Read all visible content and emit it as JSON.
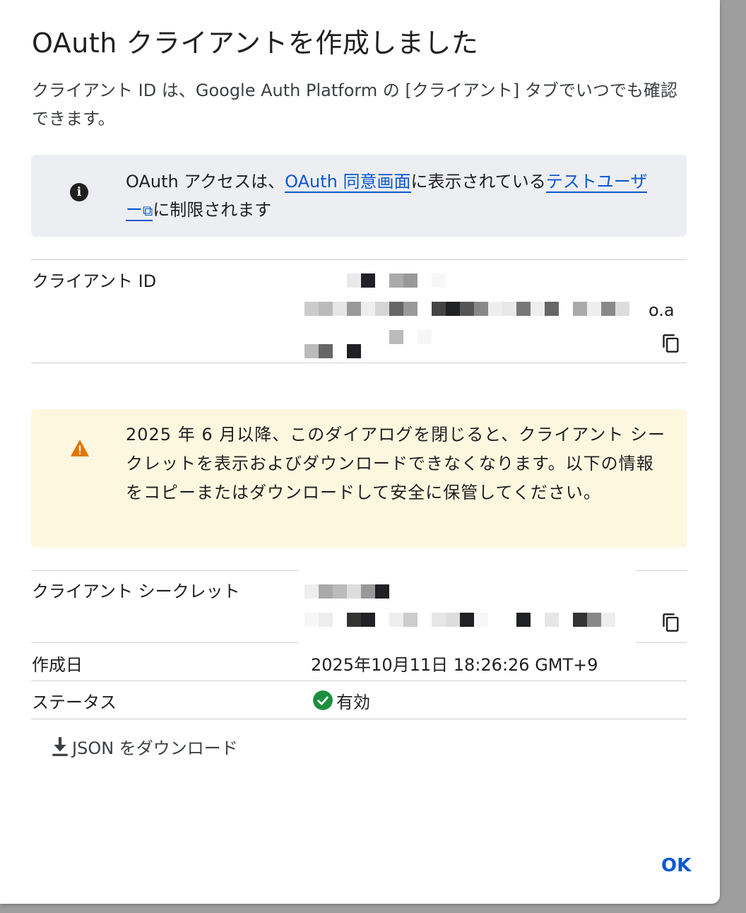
{
  "dialog": {
    "title": "OAuth クライアントを作成しました",
    "description": "クライアント ID は、Google Auth Platform の [クライアント] タブでいつでも確認できます。"
  },
  "info": {
    "icon": "info-icon",
    "text_before": "OAuth アクセスは、",
    "consent_link": "OAuth 同意画面",
    "text_middle": "に表示されている",
    "test_users_link": "テストユーザー",
    "text_after": "に制限されます"
  },
  "client_id": {
    "label": "クライアント ID",
    "visible_suffix": "o.a",
    "copy_icon": "copy-icon"
  },
  "warning": {
    "icon": "warning-icon",
    "text": "2025 年 6 月以降、このダイアログを閉じると、クライアント シークレットを表示およびダウンロードできなくなります。以下の情報をコピーまたはダウンロードして安全に保管してください。"
  },
  "client_secret": {
    "label": "クライアント シークレット",
    "copy_icon": "copy-icon"
  },
  "created": {
    "label": "作成日",
    "value": "2025年10月11日 18:26:26 GMT+9"
  },
  "status": {
    "label": "ステータス",
    "value": "有効",
    "icon": "check-circle-icon",
    "color": "#1e8e3e"
  },
  "actions": {
    "download_label": "JSON をダウンロード",
    "download_icon": "download-icon",
    "ok_label": "OK"
  },
  "colors": {
    "link": "#0b57d0",
    "info_bg": "#edeef2",
    "warning_bg": "#fef7e0",
    "warning_icon": "#e37400"
  }
}
